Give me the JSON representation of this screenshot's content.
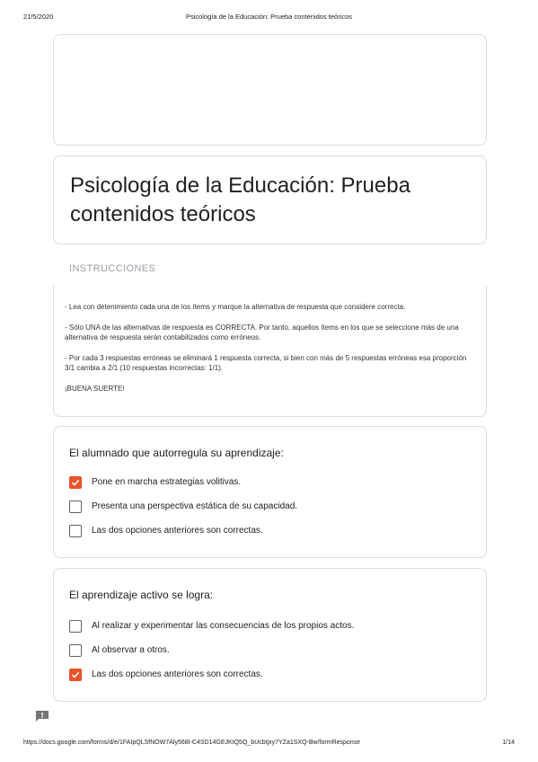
{
  "print_header": {
    "date": "21/5/2020",
    "title": "Psicología de la Educación: Prueba contenidos teóricos"
  },
  "form": {
    "title": "Psicología de la Educación: Prueba contenidos teóricos",
    "section_header": "INSTRUCCIONES",
    "instructions": [
      "- Lea con detenimiento cada una de los ítems y marque la alternativa de respuesta que considere correcta.",
      "- Sólo UNA de las alternativas de respuesta es CORRECTA. Por tanto, aquellos ítems en los que se seleccione más de una alternativa de respuesta serán contabilizados como erróneos.",
      "- Por cada 3 respuestas erróneas se eliminará 1 respuesta correcta, si bien con más de 5 respuestas erróneas esa proporción 3/1 cambia a 2/1 (10 respuestas incorrectas: 1/1).",
      "¡BUENA SUERTE!"
    ],
    "questions": [
      {
        "title": "El alumnado que autorregula su aprendizaje:",
        "options": [
          {
            "label": "Pone en marcha estrategias volitivas.",
            "checked": true
          },
          {
            "label": "Presenta una perspectiva estática de su capacidad.",
            "checked": false
          },
          {
            "label": "Las dos opciones anteriores son correctas.",
            "checked": false
          }
        ]
      },
      {
        "title": "El aprendizaje activo se logra:",
        "options": [
          {
            "label": "Al realizar y experimentar las consecuencias de los propios actos.",
            "checked": false
          },
          {
            "label": "Al observar a otros.",
            "checked": false
          },
          {
            "label": "Las dos opciones anteriores son correctas.",
            "checked": true
          }
        ]
      }
    ]
  },
  "colors": {
    "checked": "#e8532b",
    "card_border": "#dadce0"
  },
  "icons": {
    "feedback": "feedback-icon",
    "check": "check-icon"
  },
  "print_footer": {
    "url": "https://docs.google.com/forms/d/e/1FAIpQLSfNOW7Aly568I-C4SD14GEJKtQ5Q_bUcbtjxy7YZa1SXQ-Bw/formResponse",
    "page": "1/14"
  }
}
